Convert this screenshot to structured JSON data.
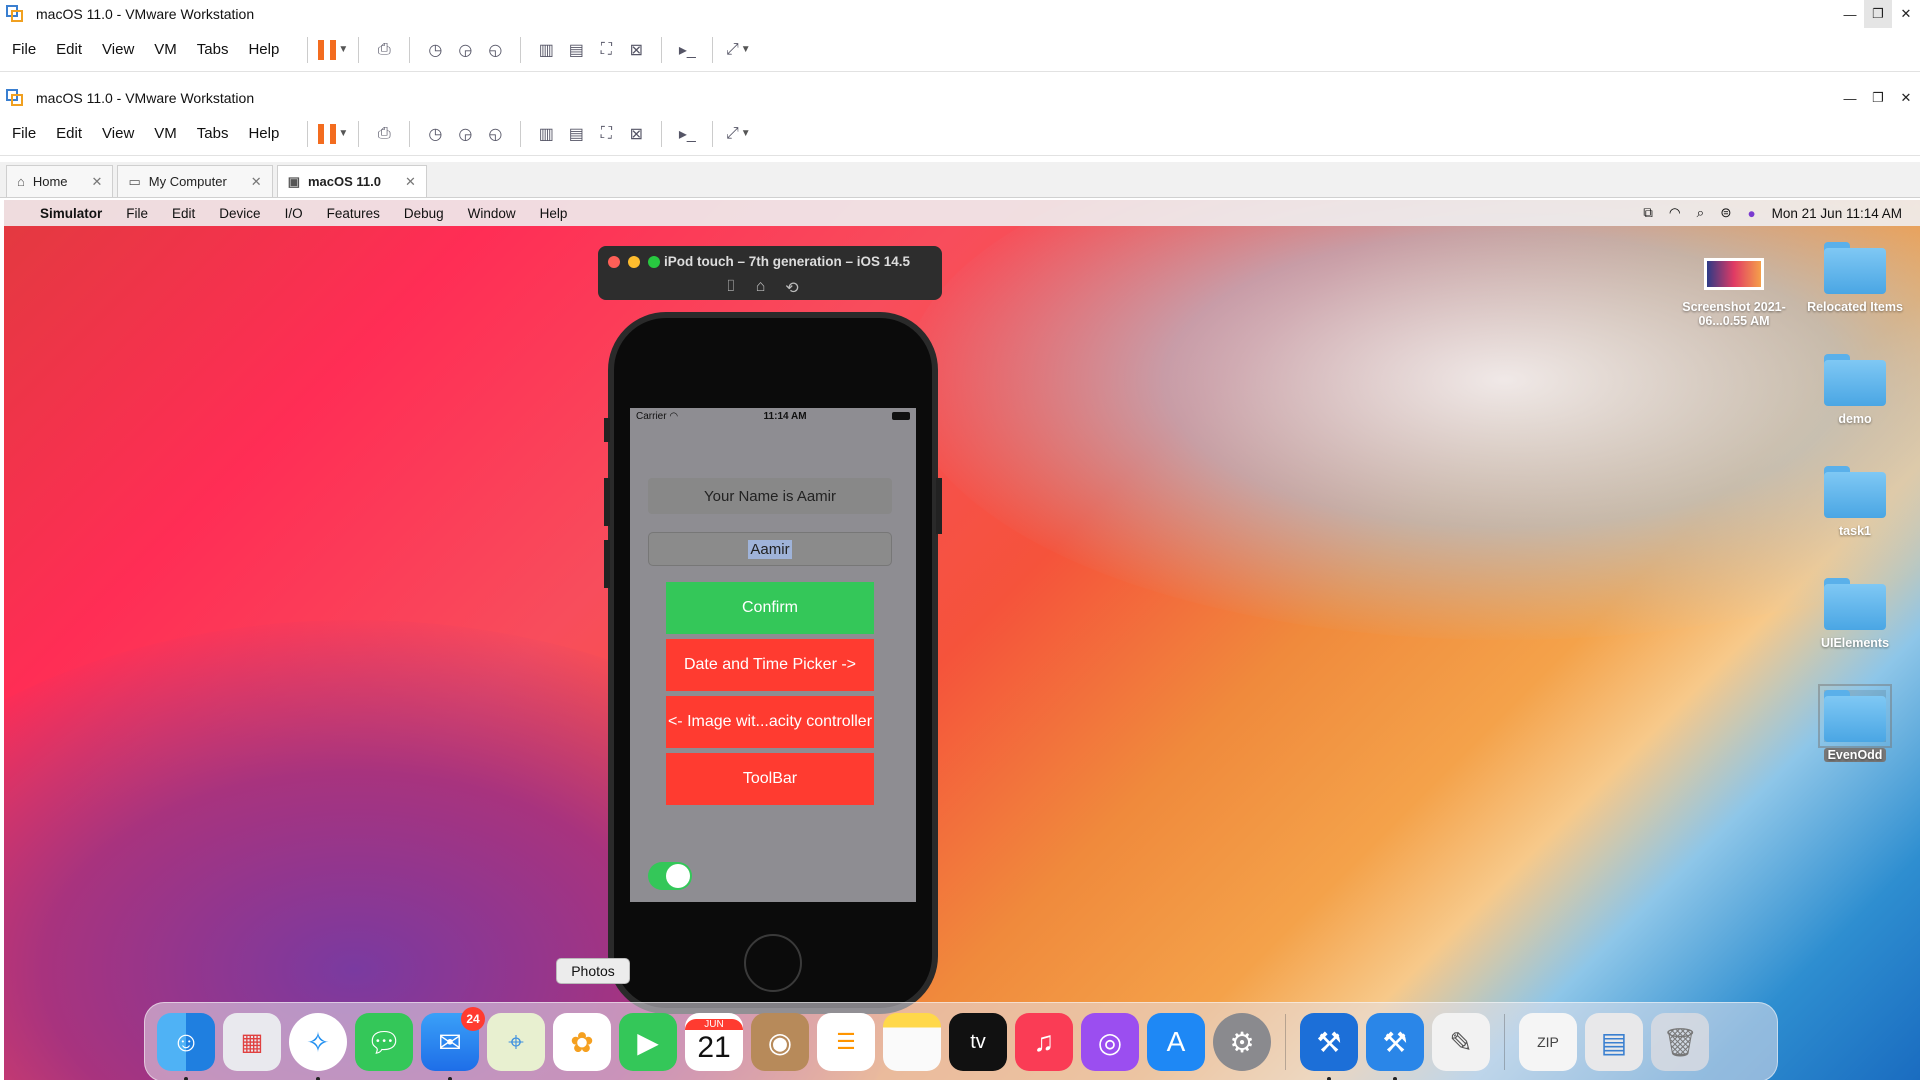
{
  "outer_window": {
    "title": "macOS 11.0 - VMware Workstation",
    "menu": [
      "File",
      "Edit",
      "View",
      "VM",
      "Tabs",
      "Help"
    ]
  },
  "inner_window": {
    "title": "macOS 11.0 - VMware Workstation",
    "menu": [
      "File",
      "Edit",
      "View",
      "VM",
      "Tabs",
      "Help"
    ]
  },
  "tabs": [
    {
      "label": "Home",
      "icon": "home-icon"
    },
    {
      "label": "My Computer",
      "icon": "computer-icon"
    },
    {
      "label": "macOS 11.0",
      "icon": "vm-icon",
      "active": true
    }
  ],
  "mac_menu": {
    "app": "Simulator",
    "items": [
      "File",
      "Edit",
      "Device",
      "I/O",
      "Features",
      "Debug",
      "Window",
      "Help"
    ],
    "clock": "Mon 21 Jun  11:14 AM"
  },
  "simulator": {
    "title": "iPod touch – 7th generation – iOS 14.5"
  },
  "ios": {
    "carrier": "Carrier",
    "time": "11:14 AM",
    "name_label": "Your Name is Aamir",
    "text_field_value": "Aamir",
    "buttons": [
      {
        "label": "Confirm",
        "color": "#34c759"
      },
      {
        "label": "Date and Time Picker ->",
        "color": "#ff3b30"
      },
      {
        "label": "<- Image wit...acity controller",
        "color": "#ff3b30"
      },
      {
        "label": "ToolBar",
        "color": "#ff3b30"
      }
    ],
    "switch_on": true
  },
  "desktop_icons": [
    {
      "name": "Screenshot 2021-06...0.55 AM",
      "type": "screenshot"
    },
    {
      "name": "Relocated Items",
      "type": "folder"
    },
    {
      "name": "demo",
      "type": "folder"
    },
    {
      "name": "task1",
      "type": "folder"
    },
    {
      "name": "UIElements",
      "type": "folder"
    },
    {
      "name": "EvenOdd",
      "type": "folder",
      "selected": true
    }
  ],
  "tooltip": "Photos",
  "dock": {
    "mail_badge": "24",
    "calendar_month": "JUN",
    "calendar_day": "21",
    "tv_label": "tv"
  }
}
